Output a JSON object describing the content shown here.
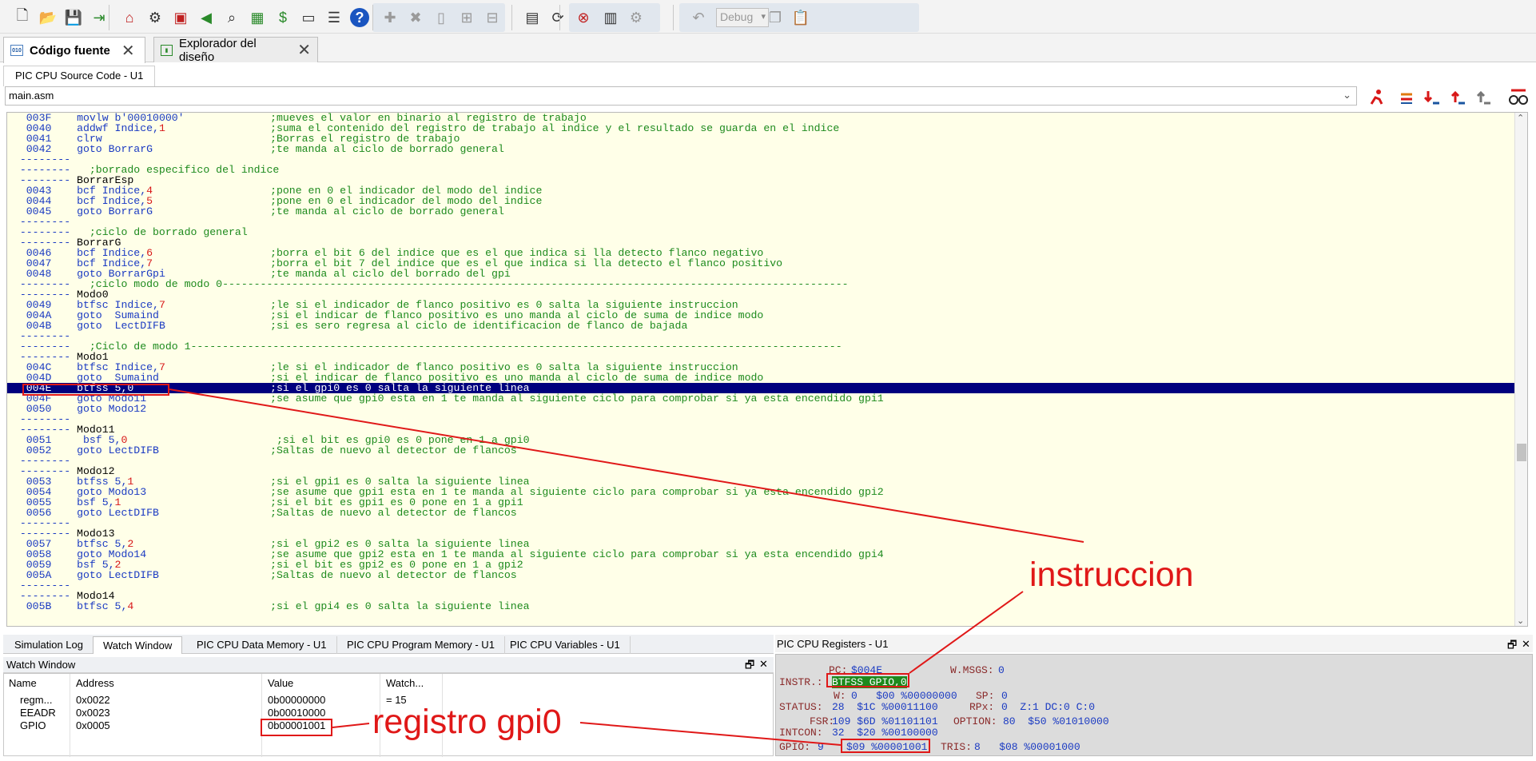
{
  "toolbar": {
    "buttons": [
      "new-icon",
      "open-icon",
      "save-icon",
      "exit-icon",
      "home-icon",
      "component-icon",
      "chip-icon",
      "play-icon",
      "find-icon",
      "board-icon",
      "price-icon",
      "binary-icon",
      "document-icon",
      "help-icon",
      "add-icon",
      "delete-icon",
      "page-icon",
      "page-add-icon",
      "page-remove-icon",
      "compile-icon",
      "build-icon",
      "stop-build-icon",
      "memory-icon",
      "settings-icon",
      "undo-icon",
      "redo-icon",
      "cut-icon",
      "copy-icon",
      "paste-icon"
    ],
    "config_value": "Debug"
  },
  "tabs": [
    {
      "label": "Código fuente",
      "icon": "code-icon"
    },
    {
      "label": "Explorador del diseño",
      "icon": "design-explorer-icon"
    }
  ],
  "editor": {
    "title": "PIC CPU Source Code - U1",
    "file": "main.asm",
    "lines": [
      {
        "a": "003F",
        "l": "",
        "i": "movlw b'00010000'",
        "c": ";mueves el valor en binario al registro de trabajo"
      },
      {
        "a": "0040",
        "l": "",
        "i": "addwf Indice,1",
        "c": ";suma el contenido del registro de trabajo al indice y el resultado se guarda en el indice"
      },
      {
        "a": "0041",
        "l": "",
        "i": "clrw",
        "c": ";Borras el registro de trabajo"
      },
      {
        "a": "0042",
        "l": "",
        "i": "goto BorrarG",
        "c": ";te manda al ciclo de borrado general"
      },
      {
        "a": "--------",
        "l": "",
        "i": "",
        "c": ""
      },
      {
        "a": "--------",
        "l": "",
        "i": "",
        "c": ";borrado especifico del indice",
        "full": true
      },
      {
        "a": "--------",
        "l": "BorrarEsp",
        "i": "",
        "c": ""
      },
      {
        "a": "0043",
        "l": "",
        "i": "bcf Indice,4",
        "c": ";pone en 0 el indicador del modo del indice"
      },
      {
        "a": "0044",
        "l": "",
        "i": "bcf Indice,5",
        "c": ";pone en 0 el indicador del modo del indice"
      },
      {
        "a": "0045",
        "l": "",
        "i": "goto BorrarG",
        "c": ";te manda al ciclo de borrado general"
      },
      {
        "a": "--------",
        "l": "",
        "i": "",
        "c": ""
      },
      {
        "a": "--------",
        "l": "",
        "i": "",
        "c": ";ciclo de borrado general",
        "full": true
      },
      {
        "a": "--------",
        "l": "BorrarG",
        "i": "",
        "c": ""
      },
      {
        "a": "0046",
        "l": "",
        "i": "bcf Indice,6",
        "c": ";borra el bit 6 del indice que es el que indica si lla detecto flanco negativo"
      },
      {
        "a": "0047",
        "l": "",
        "i": "bcf Indice,7",
        "c": ";borra el bit 7 del indice que es el que indica si lla detecto el flanco positivo"
      },
      {
        "a": "0048",
        "l": "",
        "i": "goto BorrarGpi",
        "c": ";te manda al ciclo del borrado del gpi"
      },
      {
        "a": "--------",
        "l": "",
        "i": "",
        "c": ";ciclo modo de modo 0---------------------------------------------------------------------------------------------------",
        "full": true
      },
      {
        "a": "--------",
        "l": "Modo0",
        "i": "",
        "c": ""
      },
      {
        "a": "0049",
        "l": "",
        "i": "btfsc Indice,7",
        "c": ";le si el indicador de flanco positivo es 0 salta la siguiente instruccion"
      },
      {
        "a": "004A",
        "l": "",
        "i": "goto  Sumaind",
        "c": ";si el indicar de flanco positivo es uno manda al ciclo de suma de indice modo"
      },
      {
        "a": "004B",
        "l": "",
        "i": "goto  LectDIFB",
        "c": ";si es sero regresa al ciclo de identificacion de flanco de bajada"
      },
      {
        "a": "--------",
        "l": "",
        "i": "",
        "c": ""
      },
      {
        "a": "--------",
        "l": "",
        "i": "",
        "c": ";Ciclo de modo 1-------------------------------------------------------------------------------------------------------",
        "full": true
      },
      {
        "a": "--------",
        "l": "Modo1",
        "i": "",
        "c": ""
      },
      {
        "a": "004C",
        "l": "",
        "i": "btfsc Indice,7",
        "c": ";le si el indicador de flanco positivo es 0 salta la siguiente instruccion"
      },
      {
        "a": "004D",
        "l": "",
        "i": "goto  Sumaind",
        "c": ";si el indicar de flanco positivo es uno manda al ciclo de suma de indice modo"
      },
      {
        "a": "004E",
        "l": "",
        "i": "btfss 5,0",
        "c": ";si el gpi0 es 0 salta la siguiente linea",
        "hl": true
      },
      {
        "a": "004F",
        "l": "",
        "i": "goto Modo11",
        "c": ";se asume que gpi0 esta en 1 te manda al siguiente ciclo para comprobar si ya esta encendido gpi1"
      },
      {
        "a": "0050",
        "l": "",
        "i": "goto Modo12",
        "c": ""
      },
      {
        "a": "--------",
        "l": "",
        "i": "",
        "c": ""
      },
      {
        "a": "--------",
        "l": "Modo11",
        "i": "",
        "c": ""
      },
      {
        "a": "0051",
        "l": "",
        "i": " bsf 5,0",
        "c": " ;si el bit es gpi0 es 0 pone en 1 a gpi0"
      },
      {
        "a": "0052",
        "l": "",
        "i": "goto LectDIFB",
        "c": ";Saltas de nuevo al detector de flancos"
      },
      {
        "a": "--------",
        "l": "",
        "i": "",
        "c": ""
      },
      {
        "a": "--------",
        "l": "Modo12",
        "i": "",
        "c": ""
      },
      {
        "a": "0053",
        "l": "",
        "i": "btfss 5,1",
        "c": ";si el gpi1 es 0 salta la siguiente linea"
      },
      {
        "a": "0054",
        "l": "",
        "i": "goto Modo13",
        "c": ";se asume que gpi1 esta en 1 te manda al siguiente ciclo para comprobar si ya esta encendido gpi2"
      },
      {
        "a": "0055",
        "l": "",
        "i": "bsf 5,1",
        "c": ";si el bit es gpi1 es 0 pone en 1 a gpi1"
      },
      {
        "a": "0056",
        "l": "",
        "i": "goto LectDIFB",
        "c": ";Saltas de nuevo al detector de flancos"
      },
      {
        "a": "--------",
        "l": "",
        "i": "",
        "c": ""
      },
      {
        "a": "--------",
        "l": "Modo13",
        "i": "",
        "c": ""
      },
      {
        "a": "0057",
        "l": "",
        "i": "btfsc 5,2",
        "c": ";si el gpi2 es 0 salta la siguiente linea"
      },
      {
        "a": "0058",
        "l": "",
        "i": "goto Modo14",
        "c": ";se asume que gpi2 esta en 1 te manda al siguiente ciclo para comprobar si ya esta encendido gpi4"
      },
      {
        "a": "0059",
        "l": "",
        "i": "bsf 5,2",
        "c": ";si el bit es gpi2 es 0 pone en 1 a gpi2"
      },
      {
        "a": "005A",
        "l": "",
        "i": "goto LectDIFB",
        "c": ";Saltas de nuevo al detector de flancos"
      },
      {
        "a": "--------",
        "l": "",
        "i": "",
        "c": ""
      },
      {
        "a": "--------",
        "l": "Modo14",
        "i": "",
        "c": ""
      },
      {
        "a": "005B",
        "l": "",
        "i": "btfsc 5,4",
        "c": ";si el gpi4 es 0 salta la siguiente linea"
      }
    ]
  },
  "bottom_tabs": [
    "Simulation Log",
    "Watch Window",
    "PIC CPU Data Memory - U1",
    "PIC CPU Program Memory - U1",
    "PIC CPU Variables - U1"
  ],
  "watch": {
    "title": "Watch Window",
    "columns": [
      "Name",
      "Address",
      "Value",
      "Watch..."
    ],
    "rows": [
      {
        "name": "regm...",
        "address": "0x0022",
        "value": "0b00000000",
        "watch": "= 15"
      },
      {
        "name": "EEADR",
        "address": "0x0023",
        "value": "0b00010000",
        "watch": ""
      },
      {
        "name": "GPIO",
        "address": "0x0005",
        "value": "0b00001001",
        "watch": ""
      }
    ]
  },
  "registers": {
    "title": "PIC CPU Registers - U1",
    "pc_label": "PC:",
    "pc": "$004E",
    "wmsgs_label": "W.MSGS:",
    "wmsgs": "0",
    "instr_label": "INSTR.:",
    "instr": "BTFSS GPIO,0",
    "w_label": "W:",
    "w": "0   $00 %00000000",
    "sp_label": "SP:",
    "sp": "0",
    "status_label": "STATUS:",
    "status": "28  $1C %00011100",
    "rpx_label": "RPx:",
    "rpx": "0  Z:1 DC:0 C:0",
    "fsr_label": "FSR:",
    "fsr": "109 $6D %01101101",
    "option_label": "OPTION:",
    "option": "80  $50 %01010000",
    "intcon_label": "INTCON:",
    "intcon": "32  $20 %00100000",
    "gpio_label": "GPIO:",
    "gpio": "9",
    "gpio_hex": "$09 %00001001",
    "tris_label": "TRIS:",
    "tris": "8   $08 %00001000"
  },
  "annotations": {
    "instruccion": "instruccion",
    "registro": "registro gpi0",
    "color": "#e01818"
  }
}
